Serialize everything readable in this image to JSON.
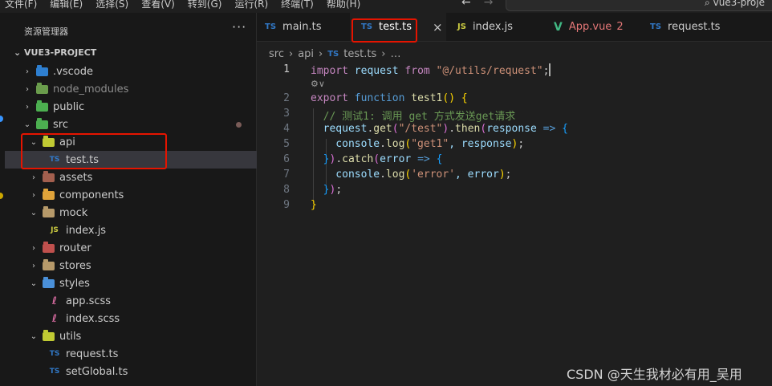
{
  "menu": [
    "文件(F)",
    "编辑(E)",
    "选择(S)",
    "查看(V)",
    "转到(G)",
    "运行(R)",
    "终端(T)",
    "帮助(H)"
  ],
  "search_text": "vue3-proje",
  "sidebar": {
    "title": "资源管理器",
    "more": "···",
    "root": "VUE3-PROJECT",
    "items": [
      {
        "label": ".vscode"
      },
      {
        "label": "node_modules"
      },
      {
        "label": "public"
      },
      {
        "label": "src"
      },
      {
        "label": "api"
      },
      {
        "label": "test.ts"
      },
      {
        "label": "assets"
      },
      {
        "label": "components"
      },
      {
        "label": "mock"
      },
      {
        "label": "index.js"
      },
      {
        "label": "router"
      },
      {
        "label": "stores"
      },
      {
        "label": "styles"
      },
      {
        "label": "app.scss"
      },
      {
        "label": "index.scss"
      },
      {
        "label": "utils"
      },
      {
        "label": "request.ts"
      },
      {
        "label": "setGlobal.ts"
      }
    ]
  },
  "tabs": [
    {
      "label": "main.ts",
      "icon": "TS"
    },
    {
      "label": "test.ts",
      "icon": "TS",
      "close": "×"
    },
    {
      "label": "index.js",
      "icon": "JS"
    },
    {
      "label": "App.vue",
      "icon": "V",
      "badge": "2"
    },
    {
      "label": "request.ts",
      "icon": "TS"
    }
  ],
  "breadcrumb": {
    "parts": [
      "src",
      "api",
      "test.ts",
      "…"
    ],
    "sep": "›",
    "file_icon": "TS"
  },
  "editor": {
    "line_numbers": [
      "1",
      "2",
      "3",
      "4",
      "5",
      "6",
      "7",
      "8",
      "9"
    ],
    "lens": "⚙∨",
    "lines": [
      [
        {
          "t": "import",
          "c": "kc"
        },
        {
          "t": " request ",
          "c": "id"
        },
        {
          "t": "from",
          "c": "kc"
        },
        {
          "t": " \"@/utils/request\"",
          "c": "str"
        },
        {
          "t": ";",
          "c": ""
        }
      ],
      [
        {
          "t": "export",
          "c": "kc"
        },
        {
          "t": " function",
          "c": "kw"
        },
        {
          "t": " test1",
          "c": "fn"
        },
        {
          "t": "(",
          "c": "b1"
        },
        {
          "t": ")",
          "c": "b1"
        },
        {
          "t": " ",
          "c": ""
        },
        {
          "t": "{",
          "c": "b1"
        }
      ],
      [
        {
          "t": "  // 测试1: 调用 get 方式发送get请求",
          "c": "cm"
        }
      ],
      [
        {
          "t": "  request",
          "c": "id"
        },
        {
          "t": ".",
          "c": ""
        },
        {
          "t": "get",
          "c": "fn"
        },
        {
          "t": "(",
          "c": "b2"
        },
        {
          "t": "\"/test\"",
          "c": "str"
        },
        {
          "t": ")",
          "c": "b2"
        },
        {
          "t": ".",
          "c": ""
        },
        {
          "t": "then",
          "c": "fn"
        },
        {
          "t": "(",
          "c": "b2"
        },
        {
          "t": "response",
          "c": "id"
        },
        {
          "t": " => ",
          "c": "kw"
        },
        {
          "t": "{",
          "c": "b3"
        }
      ],
      [
        {
          "t": "    console",
          "c": "id"
        },
        {
          "t": ".",
          "c": ""
        },
        {
          "t": "log",
          "c": "fn"
        },
        {
          "t": "(",
          "c": "b1"
        },
        {
          "t": "\"get1\"",
          "c": "str"
        },
        {
          "t": ", response",
          "c": "id"
        },
        {
          "t": ")",
          "c": "b1"
        },
        {
          "t": ";",
          "c": ""
        }
      ],
      [
        {
          "t": "  ",
          "c": ""
        },
        {
          "t": "}",
          "c": "b3"
        },
        {
          "t": ")",
          "c": "b2"
        },
        {
          "t": ".",
          "c": ""
        },
        {
          "t": "catch",
          "c": "fn"
        },
        {
          "t": "(",
          "c": "b2"
        },
        {
          "t": "error",
          "c": "id"
        },
        {
          "t": " => ",
          "c": "kw"
        },
        {
          "t": "{",
          "c": "b3"
        }
      ],
      [
        {
          "t": "    console",
          "c": "id"
        },
        {
          "t": ".",
          "c": ""
        },
        {
          "t": "log",
          "c": "fn"
        },
        {
          "t": "(",
          "c": "b1"
        },
        {
          "t": "'error'",
          "c": "str"
        },
        {
          "t": ", error",
          "c": "id"
        },
        {
          "t": ")",
          "c": "b1"
        },
        {
          "t": ";",
          "c": ""
        }
      ],
      [
        {
          "t": "  ",
          "c": ""
        },
        {
          "t": "}",
          "c": "b3"
        },
        {
          "t": ")",
          "c": "b2"
        },
        {
          "t": ";",
          "c": ""
        }
      ],
      [
        {
          "t": "}",
          "c": "b1"
        }
      ]
    ]
  },
  "watermark": "CSDN @天生我材必有用_吴用"
}
